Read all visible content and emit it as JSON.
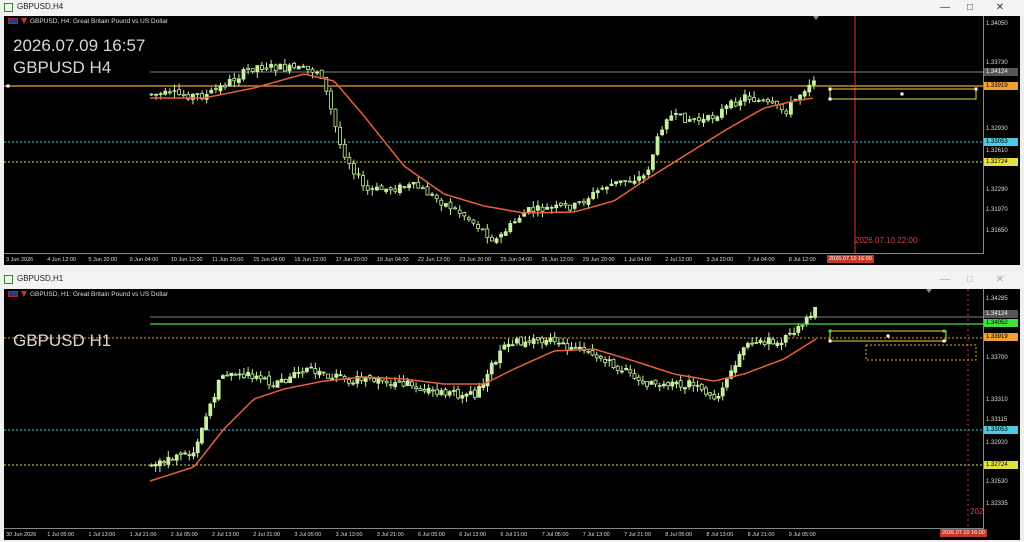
{
  "h4": {
    "window_title": "GBPUSD,H4",
    "header_text": "GBPUSD, H4: Great Britain Pound vs US Dollar",
    "datetime_overlay": "2026.07.09 16:57",
    "symbol_overlay": "GBPUSD H4",
    "y_ticks": [
      "1.34050",
      "1.33730",
      "1.32930",
      "1.32610",
      "1.32290",
      "1.31970",
      "1.31650"
    ],
    "price_badges": {
      "bid": "1.34124",
      "orange": "1.33919",
      "cyan": "1.33053",
      "yellow": "1.32724"
    },
    "x_ticks": [
      "3 Jun 2026",
      "4 Jun 12:00",
      "5 Jun 20:00",
      "9 Jun 04:00",
      "10 Jun 12:00",
      "11 Jun 20:00",
      "15 Jun 04:00",
      "16 Jun 12:00",
      "17 Jun 20:00",
      "19 Jun 04:00",
      "22 Jun 12:00",
      "23 Jun 20:00",
      "25 Jun 04:00",
      "26 Jun 12:00",
      "29 Jun 20:00",
      "1 Jul 04:00",
      "2 Jul 12:00",
      "3 Jul 20:00",
      "7 Jul 04:00",
      "8 Jul 12:00"
    ],
    "crosshair_time_badge": "2026.07.10 16:00",
    "crosshair_time_text": "2026.07.10 22:00"
  },
  "h1": {
    "window_title": "GBPUSD,H1",
    "header_text": "GBPUSD, H1: Great Britain Pound vs US Dollar",
    "symbol_overlay": "GBPUSD H1",
    "y_ticks": [
      "1.34285",
      "1.33700",
      "1.33310",
      "1.33115",
      "1.32920",
      "1.32530",
      "1.32335"
    ],
    "price_badges": {
      "bid": "1.34124",
      "green": "1.34052",
      "orange": "1.33919",
      "cyan": "1.33053",
      "yellow": "1.32724"
    },
    "x_ticks": [
      "30 Jun 2026",
      "1 Jul 05:00",
      "1 Jul 13:00",
      "1 Jul 21:00",
      "2 Jul 05:00",
      "2 Jul 13:00",
      "2 Jul 21:00",
      "3 Jul 05:00",
      "3 Jul 13:00",
      "3 Jul 21:00",
      "6 Jul 05:00",
      "6 Jul 13:00",
      "6 Jul 21:00",
      "7 Jul 05:00",
      "7 Jul 13:00",
      "7 Jul 21:00",
      "8 Jul 05:00",
      "8 Jul 13:00",
      "8 Jul 21:00",
      "9 Jul 05:00"
    ],
    "crosshair_time_badge": "2026.07.10 16:00",
    "crosshair_time_text": "202"
  },
  "window_buttons": {
    "minimize": "—",
    "maximize": "□",
    "close": "✕"
  },
  "colors": {
    "bull": "#c8f0a0",
    "ma": "#e8603c",
    "orange": "#f0a030",
    "cyan": "#4ec9e0",
    "yellow": "#e0e040",
    "green": "#40e040",
    "crosshair": "#e03030"
  }
}
